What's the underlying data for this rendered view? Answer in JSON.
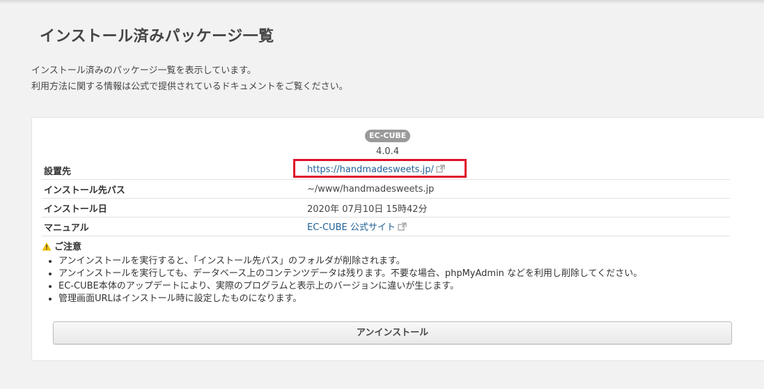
{
  "page": {
    "title": "インストール済みパッケージ一覧",
    "description_lines": [
      "インストール済みのパッケージ一覧を表示しています。",
      "利用方法に関する情報は公式で提供されているドキュメントをご覧ください。"
    ]
  },
  "package": {
    "badge": "EC-CUBE",
    "version": "4.0.4"
  },
  "info": [
    {
      "label": "設置先",
      "value": "https://handmadesweets.jp/"
    },
    {
      "label": "インストール先パス",
      "value": "~/www/handmadesweets.jp"
    },
    {
      "label": "インストール日",
      "value": "2020年 07月10日 15時42分"
    },
    {
      "label": "マニュアル",
      "value": "EC-CUBE 公式サイト"
    }
  ],
  "notice": {
    "title": "ご注意",
    "items": [
      "アンインストールを実行すると、「インストール先パス」のフォルダが削除されます。",
      "アンインストールを実行しても、データベース上のコンテンツデータは残ります。不要な場合、phpMyAdmin などを利用し削除してください。",
      "EC-CUBE本体のアップデートにより、実際のプログラムと表示上のバージョンに違いが生じます。",
      "管理画面URLはインストール時に設定したものになります。"
    ]
  },
  "actions": {
    "uninstall_label": "アンインストール"
  },
  "colors": {
    "link": "#1e5f96",
    "highlight": "#e0102a",
    "warning": "#f0c000",
    "badge": "#9a9a9a"
  },
  "icons": [
    "external-link-icon",
    "warning-icon"
  ]
}
